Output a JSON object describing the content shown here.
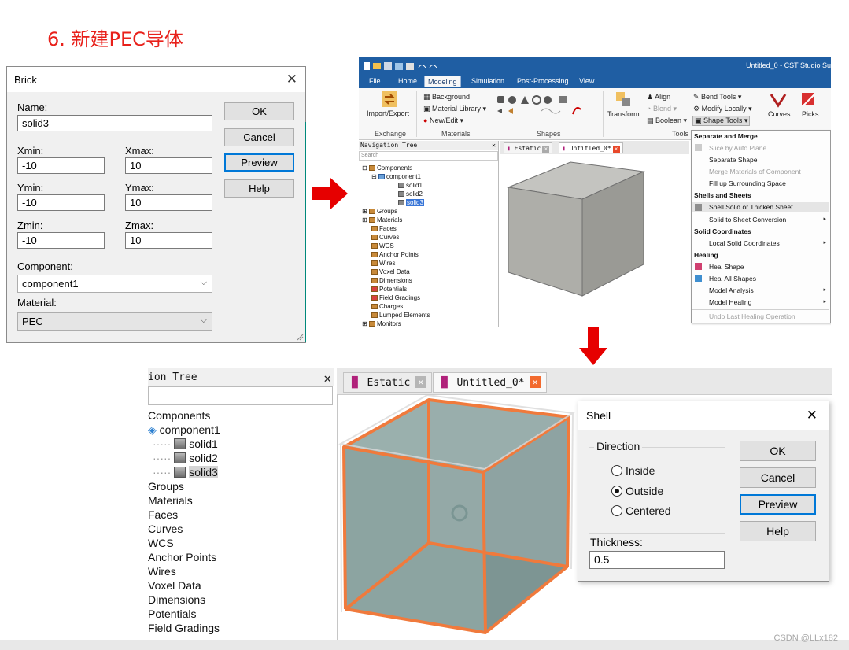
{
  "heading": "6. 新建PEC导体",
  "brick": {
    "title": "Brick",
    "close": "✕",
    "name_label": "Name:",
    "name_value": "solid3",
    "xmin_label": "Xmin:",
    "xmin_value": "-10",
    "xmax_label": "Xmax:",
    "xmax_value": "10",
    "ymin_label": "Ymin:",
    "ymin_value": "-10",
    "ymax_label": "Ymax:",
    "ymax_value": "10",
    "zmin_label": "Zmin:",
    "zmin_value": "-10",
    "zmax_label": "Zmax:",
    "zmax_value": "10",
    "component_label": "Component:",
    "component_value": "component1",
    "material_label": "Material:",
    "material_value": "PEC",
    "buttons": {
      "ok": "OK",
      "cancel": "Cancel",
      "preview": "Preview",
      "help": "Help"
    }
  },
  "cst": {
    "window_title": "Untitled_0 - CST Studio Su",
    "ribbon_tabs": [
      "File",
      "Home",
      "Modeling",
      "Simulation",
      "Post-Processing",
      "View"
    ],
    "ribbon": {
      "import_export": "Import/Export",
      "background": "Background",
      "material_library": "Material Library",
      "new_edit": "New/Edit",
      "transform": "Transform",
      "align": "Align",
      "blend": "Blend",
      "boolean": "Boolean",
      "bend_tools": "Bend Tools",
      "modify_locally": "Modify Locally",
      "shape_tools": "Shape Tools",
      "curves": "Curves",
      "picks": "Picks",
      "groups": [
        "Exchange",
        "Materials",
        "Shapes",
        "Tools"
      ]
    },
    "nav_title": "Navigation Tree",
    "nav_search": "Search",
    "tree": [
      "Components",
      "component1",
      "solid1",
      "solid2",
      "solid3",
      "Groups",
      "Materials",
      "Faces",
      "Curves",
      "WCS",
      "Anchor Points",
      "Wires",
      "Voxel Data",
      "Dimensions",
      "Potentials",
      "Field Gradings",
      "Charges",
      "Lumped Elements",
      "Monitors"
    ],
    "doc_tabs": [
      "Estatic",
      "Untitled_0*"
    ],
    "menu": {
      "h1": "Separate and Merge",
      "slice": "Slice by Auto Plane",
      "separate": "Separate Shape",
      "merge": "Merge Materials of Component",
      "fill": "Fill up Surrounding Space",
      "h2": "Shells and Sheets",
      "shell_solid": "Shell Solid or Thicken Sheet...",
      "solid_to_sheet": "Solid to Sheet Conversion",
      "h3": "Solid Coordinates",
      "local_solid": "Local Solid Coordinates",
      "h4": "Healing",
      "heal_shape": "Heal Shape",
      "heal_all": "Heal All Shapes",
      "model_analysis": "Model Analysis",
      "model_healing": "Model Healing",
      "undo_healing": "Undo Last Healing Operation"
    }
  },
  "bottom": {
    "nav_title": "ion Tree",
    "nav_close": "✕",
    "tree": [
      "Components",
      "component1",
      "solid1",
      "solid2",
      "solid3",
      "Groups",
      "Materials",
      "Faces",
      "Curves",
      "WCS",
      "Anchor Points",
      "Wires",
      "Voxel Data",
      "Dimensions",
      "Potentials",
      "Field Gradings"
    ],
    "tabs": [
      "Estatic",
      "Untitled_0*"
    ]
  },
  "shell": {
    "title": "Shell",
    "close": "✕",
    "direction_label": "Direction",
    "inside": "Inside",
    "outside": "Outside",
    "centered": "Centered",
    "selected": "Outside",
    "thickness_label": "Thickness:",
    "thickness_value": "0.5",
    "buttons": {
      "ok": "OK",
      "cancel": "Cancel",
      "preview": "Preview",
      "help": "Help"
    }
  },
  "watermark": "CSDN @LLx182",
  "colors": {
    "heading": "#e8201a",
    "arrow": "#e60000",
    "ribbon_blue": "#1f5ea3",
    "highlight_orange": "#f07a3c",
    "selection_blue": "#3875d7"
  }
}
